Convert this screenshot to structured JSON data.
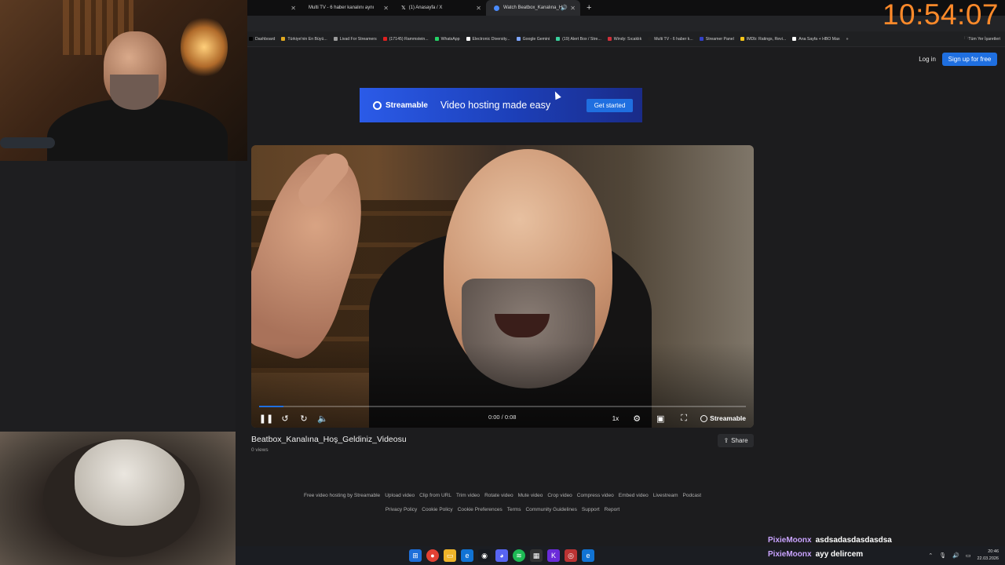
{
  "clock": "10:54:07",
  "tabs": [
    {
      "label": "Multi TV - 6 haber kanalını aynı",
      "type": "std"
    },
    {
      "label": "(1) Anasayfa / X",
      "type": "x"
    },
    {
      "label": "Watch Beatbox_Kanalına_H",
      "type": "active"
    }
  ],
  "bookmarks": [
    {
      "label": "Dashboard",
      "color": "#000000"
    },
    {
      "label": "Türkiye'nin En Büyü...",
      "color": "#e0a91f"
    },
    {
      "label": "Livad For Streamers",
      "color": "#9b9b9b"
    },
    {
      "label": "(17145) Rammstein...",
      "color": "#e02020"
    },
    {
      "label": "WhatsApp",
      "color": "#25d366"
    },
    {
      "label": "Electronic Diversity...",
      "color": "#ffffff"
    },
    {
      "label": "Google Gemini",
      "color": "#7ea6ff"
    },
    {
      "label": "(19) Alert Box / Stre...",
      "color": "#3ad29f"
    },
    {
      "label": "Windy: Sıcaklık",
      "color": "#d0303a"
    },
    {
      "label": "Multi TV - 6 haber k...",
      "color": "#222222"
    },
    {
      "label": "Streamer Panel",
      "color": "#3341c8"
    },
    {
      "label": "IMDb: Ratings, Revi...",
      "color": "#f5c518"
    },
    {
      "label": "Ana Sayfa + HBO Max",
      "color": "#ffffff"
    }
  ],
  "bookmarks_overflow": "»",
  "bookmarks_all": "Tüm Yer İşaretleri",
  "header": {
    "login": "Log in",
    "signup": "Sign up for free"
  },
  "ad": {
    "brand": "Streamable",
    "tagline": "Video hosting made easy",
    "cta": "Get started"
  },
  "player": {
    "time": "0:00 / 0:08",
    "speed": "1x",
    "brand": "Streamable",
    "progress": 0.05
  },
  "video": {
    "title": "Beatbox_Kanalına_Hoş_Geldiniz_Videosu",
    "views": "0 views",
    "share": "Share"
  },
  "footer": {
    "row1": [
      "Free video hosting by Streamable",
      "Upload video",
      "Clip from URL",
      "Trim video",
      "Rotate video",
      "Mute video",
      "Crop video",
      "Compress video",
      "Embed video",
      "Livestream",
      "Podcast"
    ],
    "row2": [
      "Privacy Policy",
      "Cookie Policy",
      "Cookie Preferences",
      "Terms",
      "Community Guidelines",
      "Support",
      "Report"
    ]
  },
  "taskbar": {
    "time": "20:46",
    "date": "22.03.2026"
  },
  "chat": [
    {
      "user": "PixieMoonx",
      "message": "asdsadasdasdasdsa"
    },
    {
      "user": "PixieMoonx",
      "message": "ayy delircem"
    }
  ]
}
